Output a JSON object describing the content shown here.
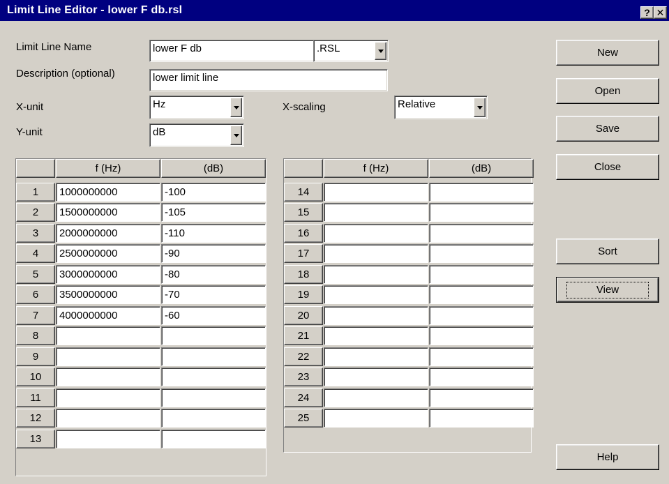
{
  "window": {
    "title": "Limit Line Editor - lower F db.rsl",
    "help_btn": "?",
    "close_btn": "✕"
  },
  "form": {
    "name_label": "Limit Line Name",
    "name_value": "lower F db",
    "ext_value": ".RSL",
    "desc_label": "Description (optional)",
    "desc_value": "lower limit line",
    "xunit_label": "X-unit",
    "xunit_value": "Hz",
    "yunit_label": "Y-unit",
    "yunit_value": "dB",
    "xscale_label": "X-scaling",
    "xscale_value": "Relative"
  },
  "table": {
    "headers": [
      "f (Hz)",
      "(dB)"
    ],
    "left_rows": [
      {
        "n": "1",
        "f": "1000000000",
        "db": "-100"
      },
      {
        "n": "2",
        "f": "1500000000",
        "db": "-105"
      },
      {
        "n": "3",
        "f": "2000000000",
        "db": "-110"
      },
      {
        "n": "4",
        "f": "2500000000",
        "db": "-90"
      },
      {
        "n": "5",
        "f": "3000000000",
        "db": "-80"
      },
      {
        "n": "6",
        "f": "3500000000",
        "db": "-70"
      },
      {
        "n": "7",
        "f": "4000000000",
        "db": "-60"
      },
      {
        "n": "8",
        "f": "",
        "db": ""
      },
      {
        "n": "9",
        "f": "",
        "db": ""
      },
      {
        "n": "10",
        "f": "",
        "db": ""
      },
      {
        "n": "11",
        "f": "",
        "db": ""
      },
      {
        "n": "12",
        "f": "",
        "db": ""
      },
      {
        "n": "13",
        "f": "",
        "db": ""
      }
    ],
    "right_rows": [
      {
        "n": "14",
        "f": "",
        "db": ""
      },
      {
        "n": "15",
        "f": "",
        "db": ""
      },
      {
        "n": "16",
        "f": "",
        "db": ""
      },
      {
        "n": "17",
        "f": "",
        "db": ""
      },
      {
        "n": "18",
        "f": "",
        "db": ""
      },
      {
        "n": "19",
        "f": "",
        "db": ""
      },
      {
        "n": "20",
        "f": "",
        "db": ""
      },
      {
        "n": "21",
        "f": "",
        "db": ""
      },
      {
        "n": "22",
        "f": "",
        "db": ""
      },
      {
        "n": "23",
        "f": "",
        "db": ""
      },
      {
        "n": "24",
        "f": "",
        "db": ""
      },
      {
        "n": "25",
        "f": "",
        "db": ""
      }
    ]
  },
  "buttons": {
    "new": "New",
    "open": "Open",
    "save": "Save",
    "close": "Close",
    "sort": "Sort",
    "view": "View",
    "help": "Help"
  },
  "colors": {
    "titlebar": "#000080",
    "face": "#d4d0c8"
  }
}
